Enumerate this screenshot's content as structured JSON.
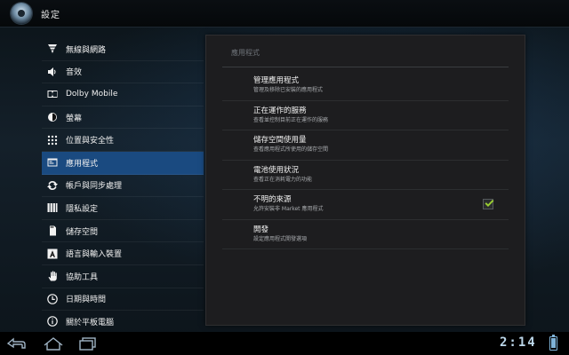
{
  "app": {
    "title": "設定"
  },
  "sidebar": {
    "items": [
      {
        "label": "無線與網路",
        "icon": "wireless-icon"
      },
      {
        "label": "音效",
        "icon": "speaker-icon"
      },
      {
        "label": "Dolby Mobile",
        "icon": "dolby-icon"
      },
      {
        "label": "螢幕",
        "icon": "brightness-icon"
      },
      {
        "label": "位置與安全性",
        "icon": "location-grid-icon"
      },
      {
        "label": "應用程式",
        "icon": "apps-icon",
        "active": true
      },
      {
        "label": "帳戶與同步處理",
        "icon": "sync-icon"
      },
      {
        "label": "隱私設定",
        "icon": "privacy-icon"
      },
      {
        "label": "儲存空間",
        "icon": "storage-icon"
      },
      {
        "label": "語言與輸入裝置",
        "icon": "language-icon"
      },
      {
        "label": "協助工具",
        "icon": "accessibility-hand-icon"
      },
      {
        "label": "日期與時間",
        "icon": "clock-icon"
      },
      {
        "label": "關於平板電腦",
        "icon": "info-icon"
      }
    ]
  },
  "panel": {
    "header": "應用程式",
    "rows": [
      {
        "title": "管理應用程式",
        "subtitle": "管理及移除已安裝的應用程式"
      },
      {
        "title": "正在運作的服務",
        "subtitle": "查看並控制目前正在運作的服務"
      },
      {
        "title": "儲存空間使用量",
        "subtitle": "查看應用程式所使用的儲存空間"
      },
      {
        "title": "電池使用狀況",
        "subtitle": "查看正在消耗電力的功能"
      },
      {
        "title": "不明的來源",
        "subtitle": "允許安裝非 Market 應用程式",
        "checkbox": true,
        "checked": true
      },
      {
        "title": "開發",
        "subtitle": "設定應用程式開發選項"
      }
    ]
  },
  "status": {
    "time": "2:14"
  },
  "colors": {
    "accent": "#1a4a80",
    "check": "#9acd32",
    "clock": "#bcd7ea"
  }
}
